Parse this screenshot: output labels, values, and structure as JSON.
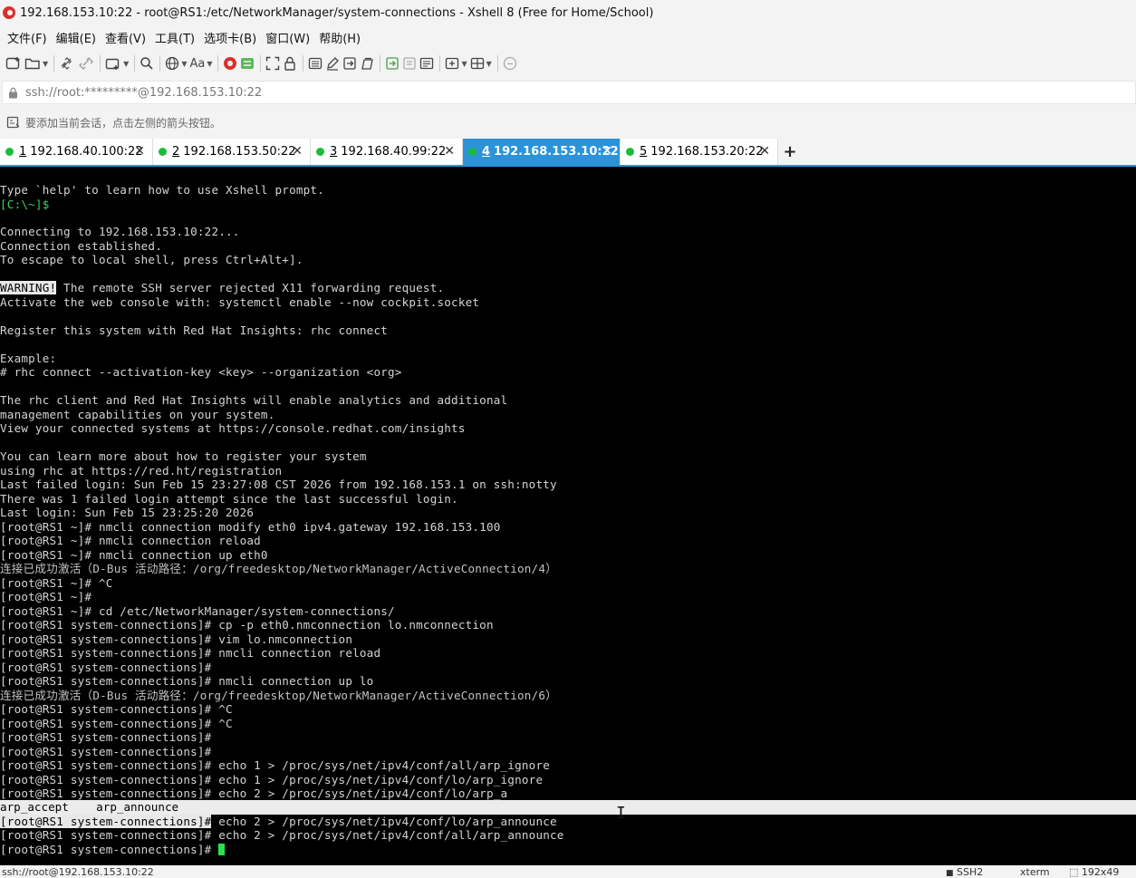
{
  "window": {
    "title": "192.168.153.10:22 - root@RS1:/etc/NetworkManager/system-connections - Xshell 8 (Free for Home/School)"
  },
  "menu": {
    "items": [
      "文件(F)",
      "编辑(E)",
      "查看(V)",
      "工具(T)",
      "选项卡(B)",
      "窗口(W)",
      "帮助(H)"
    ]
  },
  "toolbar": {
    "icons": [
      "new-session-icon",
      "open-folder-icon",
      "disconnect-icon",
      "reconnect-icon",
      "new-tab-icon",
      "search-icon",
      "globe-icon",
      "font-icon",
      "xftp-icon",
      "xmanager-icon",
      "fullscreen-icon",
      "lock-icon",
      "keyboard-icon",
      "compose-icon",
      "script-icon",
      "log-icon",
      "transfer-icon",
      "sftp-icon",
      "notes-icon",
      "layout-add-icon",
      "layout-icon",
      "help-icon"
    ],
    "font_label": "Aa"
  },
  "address": {
    "value": "ssh://root:*********@192.168.153.10:22"
  },
  "hint": {
    "text": "要添加当前会话，点击左侧的箭头按钮。"
  },
  "tabs": [
    {
      "num": "1",
      "label": " 192.168.40.100:22",
      "active": false
    },
    {
      "num": "2",
      "label": " 192.168.153.50:22",
      "active": false
    },
    {
      "num": "3",
      "label": " 192.168.40.99:22",
      "active": false
    },
    {
      "num": "4",
      "label": " 192.168.153.10:22",
      "active": true
    },
    {
      "num": "5",
      "label": " 192.168.153.20:22",
      "active": false
    }
  ],
  "terminal": {
    "lines": [
      "Type `help' to learn how to use Xshell prompt.",
      "[C:\\~]$",
      "",
      "Connecting to 192.168.153.10:22...",
      "Connection established.",
      "To escape to local shell, press Ctrl+Alt+].",
      "",
      " The remote SSH server rejected X11 forwarding request.",
      "Activate the web console with: systemctl enable --now cockpit.socket",
      "",
      "Register this system with Red Hat Insights: rhc connect",
      "",
      "Example:",
      "# rhc connect --activation-key <key> --organization <org>",
      "",
      "The rhc client and Red Hat Insights will enable analytics and additional",
      "management capabilities on your system.",
      "View your connected systems at https://console.redhat.com/insights",
      "",
      "You can learn more about how to register your system",
      "using rhc at https://red.ht/registration",
      "Last failed login: Sun Feb 15 23:27:08 CST 2026 from 192.168.153.1 on ssh:notty",
      "There was 1 failed login attempt since the last successful login.",
      "Last login: Sun Feb 15 23:25:20 2026",
      "[root@RS1 ~]# nmcli connection modify eth0 ipv4.gateway 192.168.153.100",
      "[root@RS1 ~]# nmcli connection reload",
      "[root@RS1 ~]# nmcli connection up eth0",
      "连接已成功激活（D-Bus 活动路径：/org/freedesktop/NetworkManager/ActiveConnection/4）",
      "[root@RS1 ~]# ^C",
      "[root@RS1 ~]#",
      "[root@RS1 ~]# cd /etc/NetworkManager/system-connections/",
      "[root@RS1 system-connections]# cp -p eth0.nmconnection lo.nmconnection",
      "[root@RS1 system-connections]# vim lo.nmconnection",
      "[root@RS1 system-connections]# nmcli connection reload",
      "[root@RS1 system-connections]#",
      "[root@RS1 system-connections]# nmcli connection up lo",
      "连接已成功激活（D-Bus 活动路径：/org/freedesktop/NetworkManager/ActiveConnection/6）",
      "[root@RS1 system-connections]# ^C",
      "[root@RS1 system-connections]# ^C",
      "[root@RS1 system-connections]#",
      "[root@RS1 system-connections]#",
      "[root@RS1 system-connections]# echo 1 > /proc/sys/net/ipv4/conf/all/arp_ignore",
      "[root@RS1 system-connections]# echo 1 > /proc/sys/net/ipv4/conf/lo/arp_ignore",
      "[root@RS1 system-connections]# echo 2 > /proc/sys/net/ipv4/conf/lo/arp_a"
    ],
    "warning_tag": "WARNING!",
    "completion": "arp_accept    arp_announce",
    "after_lines": [
      {
        "prompt": "[root@RS1 system-connections]#",
        "cmd": " echo 2 > /proc/sys/net/ipv4/conf/lo/arp_announce"
      },
      {
        "prompt": "[root@RS1 system-connections]#",
        "cmd": " echo 2 > /proc/sys/net/ipv4/conf/all/arp_announce"
      },
      {
        "prompt": "[root@RS1 system-connections]#",
        "cmd": " "
      }
    ]
  },
  "status": {
    "left": "ssh://root@192.168.153.10:22",
    "protocol": "SSH2",
    "term": "xterm",
    "size": "192x49"
  },
  "colors": {
    "active_tab": "#2b93d9",
    "tab_dot": "#1dbb3a",
    "terminal_bg": "#000000",
    "prompt_green": "#3bd45b",
    "cursor": "#2fe04a"
  }
}
